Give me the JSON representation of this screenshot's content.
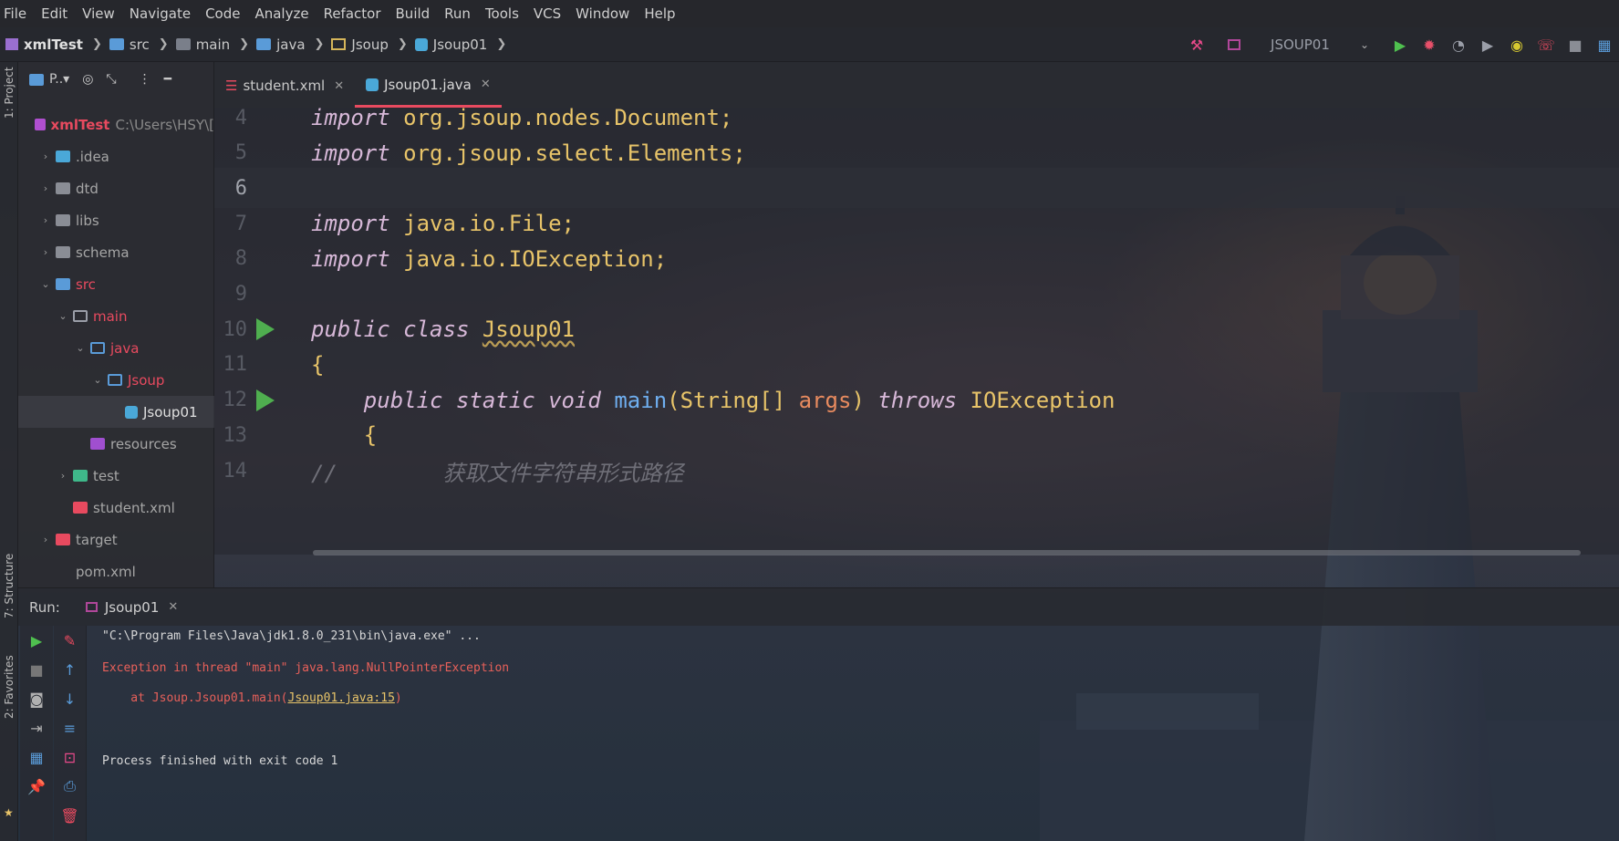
{
  "menu": [
    "File",
    "Edit",
    "View",
    "Navigate",
    "Code",
    "Analyze",
    "Refactor",
    "Build",
    "Run",
    "Tools",
    "VCS",
    "Window",
    "Help"
  ],
  "breadcrumb": {
    "project": "xmlTest",
    "items": [
      "src",
      "main",
      "java",
      "Jsoup",
      "Jsoup01"
    ]
  },
  "toolbar": {
    "run_config": "JSOUP01",
    "icons": [
      "hammer-icon",
      "run-icon",
      "debug-icon",
      "coverage-icon",
      "profile-icon",
      "attach-icon",
      "phone-icon",
      "stop-icon",
      "layout-icon"
    ]
  },
  "left_strip": {
    "project_label": "1: Project",
    "structure_label": "7: Structure",
    "favorites_label": "2: Favorites"
  },
  "project_panel": {
    "header_label": "P..▾",
    "tree": [
      {
        "label": "xmlTest",
        "sub": "C:\\Users\\HSY\\[",
        "depth": 0,
        "arrow": "",
        "kind": "module"
      },
      {
        "label": ".idea",
        "depth": 1,
        "arrow": "›",
        "kind": "folder-idea"
      },
      {
        "label": "dtd",
        "depth": 1,
        "arrow": "›",
        "kind": "folder"
      },
      {
        "label": "libs",
        "depth": 1,
        "arrow": "›",
        "kind": "folder"
      },
      {
        "label": "schema",
        "depth": 1,
        "arrow": "›",
        "kind": "folder"
      },
      {
        "label": "src",
        "depth": 1,
        "arrow": "⌄",
        "kind": "folder-src"
      },
      {
        "label": "main",
        "depth": 2,
        "arrow": "⌄",
        "kind": "folder-outline"
      },
      {
        "label": "java",
        "depth": 3,
        "arrow": "⌄",
        "kind": "folder-blue-outline"
      },
      {
        "label": "Jsoup",
        "depth": 4,
        "arrow": "⌄",
        "kind": "package"
      },
      {
        "label": "Jsoup01",
        "depth": 5,
        "arrow": "",
        "kind": "class",
        "selected": true
      },
      {
        "label": "resources",
        "depth": 3,
        "arrow": "",
        "kind": "resources"
      },
      {
        "label": "test",
        "depth": 2,
        "arrow": "›",
        "kind": "folder-test"
      },
      {
        "label": "student.xml",
        "depth": 2,
        "arrow": "",
        "kind": "xml"
      },
      {
        "label": "target",
        "depth": 1,
        "arrow": "›",
        "kind": "folder-target"
      },
      {
        "label": "pom.xml",
        "depth": 1,
        "arrow": "",
        "kind": "maven"
      }
    ]
  },
  "editor_tabs": [
    {
      "label": "student.xml",
      "active": false,
      "icon": "xml-file-icon"
    },
    {
      "label": "Jsoup01.java",
      "active": true,
      "icon": "java-class-icon"
    }
  ],
  "code_lines": [
    {
      "num": "4",
      "parts": [
        [
          "kw",
          "import"
        ],
        [
          "plain",
          " org.jsoup.nodes.Document;"
        ]
      ]
    },
    {
      "num": "5",
      "parts": [
        [
          "kw",
          "import"
        ],
        [
          "plain",
          " org.jsoup.select.Elements;"
        ]
      ]
    },
    {
      "num": "6",
      "parts": [],
      "current": true
    },
    {
      "num": "7",
      "parts": [
        [
          "kw",
          "import"
        ],
        [
          "plain",
          " java.io.File;"
        ]
      ]
    },
    {
      "num": "8",
      "parts": [
        [
          "kw",
          "import"
        ],
        [
          "plain",
          " java.io.IOException;"
        ]
      ]
    },
    {
      "num": "9",
      "parts": []
    },
    {
      "num": "10",
      "parts": [
        [
          "kw",
          "public class "
        ],
        [
          "cls",
          "Jsoup01"
        ]
      ],
      "run": true
    },
    {
      "num": "11",
      "parts": [
        [
          "plain",
          "{"
        ]
      ]
    },
    {
      "num": "12",
      "parts": [
        [
          "plain",
          "    "
        ],
        [
          "kw",
          "public static void "
        ],
        [
          "fn",
          "main"
        ],
        [
          "plain",
          "(String[] "
        ],
        [
          "param",
          "args"
        ],
        [
          "plain",
          ") "
        ],
        [
          "kw",
          "throws "
        ],
        [
          "plain",
          "IOException"
        ]
      ],
      "run": true
    },
    {
      "num": "13",
      "parts": [
        [
          "plain",
          "    {"
        ]
      ]
    },
    {
      "num": "14",
      "parts": [
        [
          "comment",
          "//        获取文件字符串形式路径"
        ]
      ]
    }
  ],
  "run_panel": {
    "label": "Run:",
    "tab": "Jsoup01",
    "console": [
      {
        "text": "\"C:\\Program Files\\Java\\jdk1.8.0_231\\bin\\java.exe\" ...",
        "style": "normal"
      },
      {
        "text": "Exception in thread \"main\" java.lang.NullPointerException",
        "style": "error"
      },
      {
        "text_prefix": "    at Jsoup.Jsoup01.main(",
        "link": "Jsoup01.java:15",
        "text_suffix": ")",
        "style": "error"
      },
      {
        "text": "",
        "style": "normal"
      },
      {
        "text": "Process finished with exit code 1",
        "style": "normal"
      }
    ]
  }
}
